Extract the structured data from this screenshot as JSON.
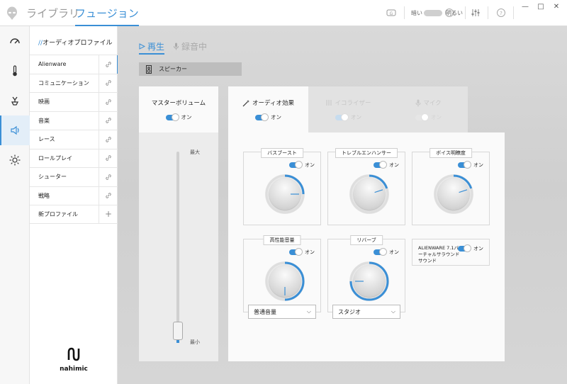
{
  "topbar": {
    "tabs": [
      {
        "label": "ライブラリ",
        "active": false
      },
      {
        "label": "フュージョン",
        "active": true
      }
    ],
    "theme_dark_label": "暗い",
    "theme_light_label": "明るい",
    "icons": [
      "g-key-icon",
      "equalizer-settings-icon",
      "help-icon"
    ],
    "window_controls": [
      "—",
      "□",
      "✕"
    ]
  },
  "rail": {
    "items": [
      {
        "name": "performance-gauge-icon",
        "glyph": "◜"
      },
      {
        "name": "thermal-icon",
        "glyph": "🌡"
      },
      {
        "name": "power-plug-icon",
        "glyph": "⏚"
      },
      {
        "name": "audio-speaker-icon",
        "glyph": "🔈",
        "active": true
      },
      {
        "name": "lighting-icon",
        "glyph": "✺"
      }
    ]
  },
  "profiles": {
    "title_prefix": "//",
    "title": "オーディオプロファイル",
    "items": [
      {
        "label": "Alienware",
        "active": true
      },
      {
        "label": "コミュニケーション"
      },
      {
        "label": "映画"
      },
      {
        "label": "音楽"
      },
      {
        "label": "レース"
      },
      {
        "label": "ロールプレイ"
      },
      {
        "label": "シューター"
      },
      {
        "label": "戦略"
      }
    ],
    "new_profile_label": "新プロファイル",
    "brand_name": "nahimic"
  },
  "main": {
    "mode_tabs": [
      {
        "label": "再生",
        "active": true
      },
      {
        "label": "録音中",
        "active": false
      }
    ],
    "device_label": "スピーカー",
    "master": {
      "title": "マスターボリューム",
      "toggle_label": "オン",
      "max_label": "最大",
      "min_label": "最小",
      "volume_percent": 3
    },
    "effect_tabs": [
      {
        "label": "オーディオ効果",
        "toggle_label": "オン",
        "active": true
      },
      {
        "label": "イコライザー",
        "toggle_label": "オン",
        "active": false
      },
      {
        "label": "マイク",
        "toggle_label": "オン",
        "active": false
      }
    ],
    "cards": [
      {
        "title": "バスブースト",
        "toggle_label": "オン",
        "level": 0.25
      },
      {
        "title": "トレブルエンハンサー",
        "toggle_label": "オン",
        "level": 0.2
      },
      {
        "title": "ボイス明瞭度",
        "toggle_label": "オン",
        "level": 0.2
      },
      {
        "title": "高性能音量",
        "toggle_label": "オン",
        "level": 0.5,
        "select_value": "普通音量"
      },
      {
        "title": "リバーブ",
        "toggle_label": "オン",
        "level": 0.75,
        "select_value": "スタジオ"
      }
    ],
    "surround": {
      "label": "ALIENWARE 7.1バーチャルサラウンドサウンド",
      "toggle_label": "オン"
    }
  },
  "colors": {
    "accent": "#3a8fd6",
    "background": "#d4d4d4",
    "panel": "#fafafa"
  }
}
